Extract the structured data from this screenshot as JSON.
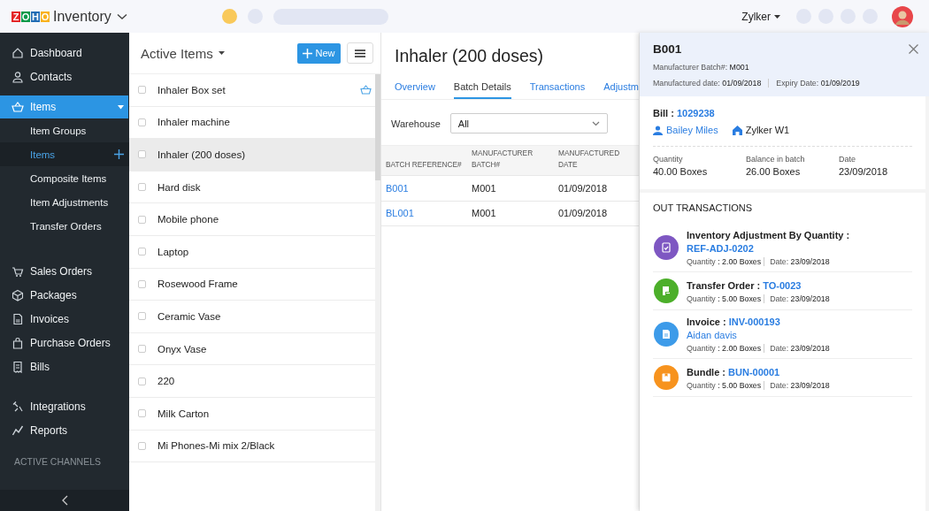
{
  "top_bar": {
    "logo_letters": [
      {
        "char": "Z",
        "color": "#e42527"
      },
      {
        "char": "O",
        "color": "#089949"
      },
      {
        "char": "H",
        "color": "#226db4"
      },
      {
        "char": "O",
        "color": "#f9b21d"
      }
    ],
    "product": "Inventory",
    "org": "Zylker"
  },
  "sidebar": {
    "groups": [
      [
        {
          "label": "Dashboard",
          "kind": "dashboard",
          "selected": false
        },
        {
          "label": "Contacts",
          "kind": "contacts",
          "selected": false
        },
        {
          "label": "Items",
          "kind": "items",
          "selected": true,
          "expanded": true,
          "children": [
            {
              "label": "Item Groups",
              "selected": false
            },
            {
              "label": "Items",
              "selected": true
            },
            {
              "label": "Composite Items",
              "selected": false
            },
            {
              "label": "Item Adjustments",
              "selected": false
            },
            {
              "label": "Transfer Orders",
              "selected": false
            }
          ]
        }
      ],
      [
        {
          "label": "Sales Orders",
          "kind": "cart",
          "selected": false
        },
        {
          "label": "Packages",
          "kind": "package",
          "selected": false
        },
        {
          "label": "Invoices",
          "kind": "invoice",
          "selected": false
        },
        {
          "label": "Purchase Orders",
          "kind": "bag",
          "selected": false
        },
        {
          "label": "Bills",
          "kind": "bill",
          "selected": false
        }
      ],
      [
        {
          "label": "Integrations",
          "kind": "integrations",
          "selected": false
        },
        {
          "label": "Reports",
          "kind": "reports",
          "selected": false
        }
      ]
    ],
    "section_label": "ACTIVE CHANNELS"
  },
  "item_list": {
    "title": "Active Items",
    "new_button": "New",
    "items": [
      {
        "name": "Inhaler Box set",
        "checked": false,
        "selected": false,
        "composite": true
      },
      {
        "name": "Inhaler machine",
        "checked": false,
        "selected": false,
        "composite": false
      },
      {
        "name": "Inhaler (200 doses)",
        "checked": false,
        "selected": true,
        "composite": false
      },
      {
        "name": "Hard disk",
        "checked": false,
        "selected": false,
        "composite": false
      },
      {
        "name": "Mobile phone",
        "checked": false,
        "selected": false,
        "composite": false
      },
      {
        "name": "Laptop",
        "checked": false,
        "selected": false,
        "composite": false
      },
      {
        "name": "Rosewood Frame",
        "checked": false,
        "selected": false,
        "composite": false
      },
      {
        "name": "Ceramic Vase",
        "checked": false,
        "selected": false,
        "composite": false
      },
      {
        "name": "Onyx Vase",
        "checked": false,
        "selected": false,
        "composite": false
      },
      {
        "name": "220",
        "checked": false,
        "selected": false,
        "composite": false
      },
      {
        "name": "Milk Carton",
        "checked": false,
        "selected": false,
        "composite": false
      },
      {
        "name": "Mi Phones-Mi mix 2/Black",
        "checked": false,
        "selected": false,
        "composite": false
      }
    ]
  },
  "detail": {
    "title": "Inhaler (200 doses)",
    "tabs": [
      {
        "label": "Overview",
        "selected": false
      },
      {
        "label": "Batch Details",
        "selected": true
      },
      {
        "label": "Transactions",
        "selected": false
      },
      {
        "label": "Adjustm",
        "selected": false
      }
    ],
    "warehouse_label": "Warehouse",
    "warehouse_value": "All",
    "table": {
      "columns": [
        "BATCH REFERENCE#",
        "MANUFACTURER BATCH#",
        "MANUFACTURED DATE"
      ],
      "rows": [
        [
          "B001",
          "M001",
          "01/09/2018"
        ],
        [
          "BL001",
          "M001",
          "01/09/2018"
        ]
      ]
    }
  },
  "batch_panel": {
    "title": "B001",
    "meta": [
      [
        {
          "label": "Manufacturer Batch#:",
          "value": "M001"
        }
      ],
      [
        {
          "label": "Manufactured date:",
          "value": "01/09/2018"
        },
        {
          "label": "Expiry Date:",
          "value": "01/09/2019"
        }
      ]
    ],
    "bill_label": "Bill :",
    "bill_number": "1029238",
    "vendor": "Bailey Miles",
    "warehouse": "Zylker W1",
    "stats": [
      {
        "label": "Quantity",
        "value": "40.00 Boxes"
      },
      {
        "label": "Balance in batch",
        "value": "26.00 Boxes"
      },
      {
        "label": "Date",
        "value": "23/09/2018"
      }
    ],
    "out_title": "OUT TRANSACTIONS",
    "transactions": [
      {
        "kind": "adjustment",
        "color": "#7e57c2",
        "label": "Inventory Adjustment By Quantity :",
        "ref": "REF-ADJ-0202",
        "quantity_label": "Quantity",
        "quantity": ": 2.00 Boxes",
        "date_label": "Date:",
        "date": "23/09/2018"
      },
      {
        "kind": "transfer",
        "color": "#4caf2a",
        "label": "Transfer Order :",
        "ref": "TO-0023",
        "quantity_label": "Quantity",
        "quantity": ": 5.00 Boxes",
        "date_label": "Date:",
        "date": "23/09/2018"
      },
      {
        "kind": "invoice",
        "color": "#3d9be9",
        "label": "Invoice :",
        "ref": "INV-000193",
        "contact": "Aidan davis",
        "quantity_label": "Quantity",
        "quantity": ": 2.00 Boxes",
        "date_label": "Date:",
        "date": "23/09/2018"
      },
      {
        "kind": "bundle",
        "color": "#f7931e",
        "label": "Bundle :",
        "ref": "BUN-00001",
        "quantity_label": "Quantity",
        "quantity": ": 5.00 Boxes",
        "date_label": "Date:",
        "date": "23/09/2018"
      }
    ]
  }
}
